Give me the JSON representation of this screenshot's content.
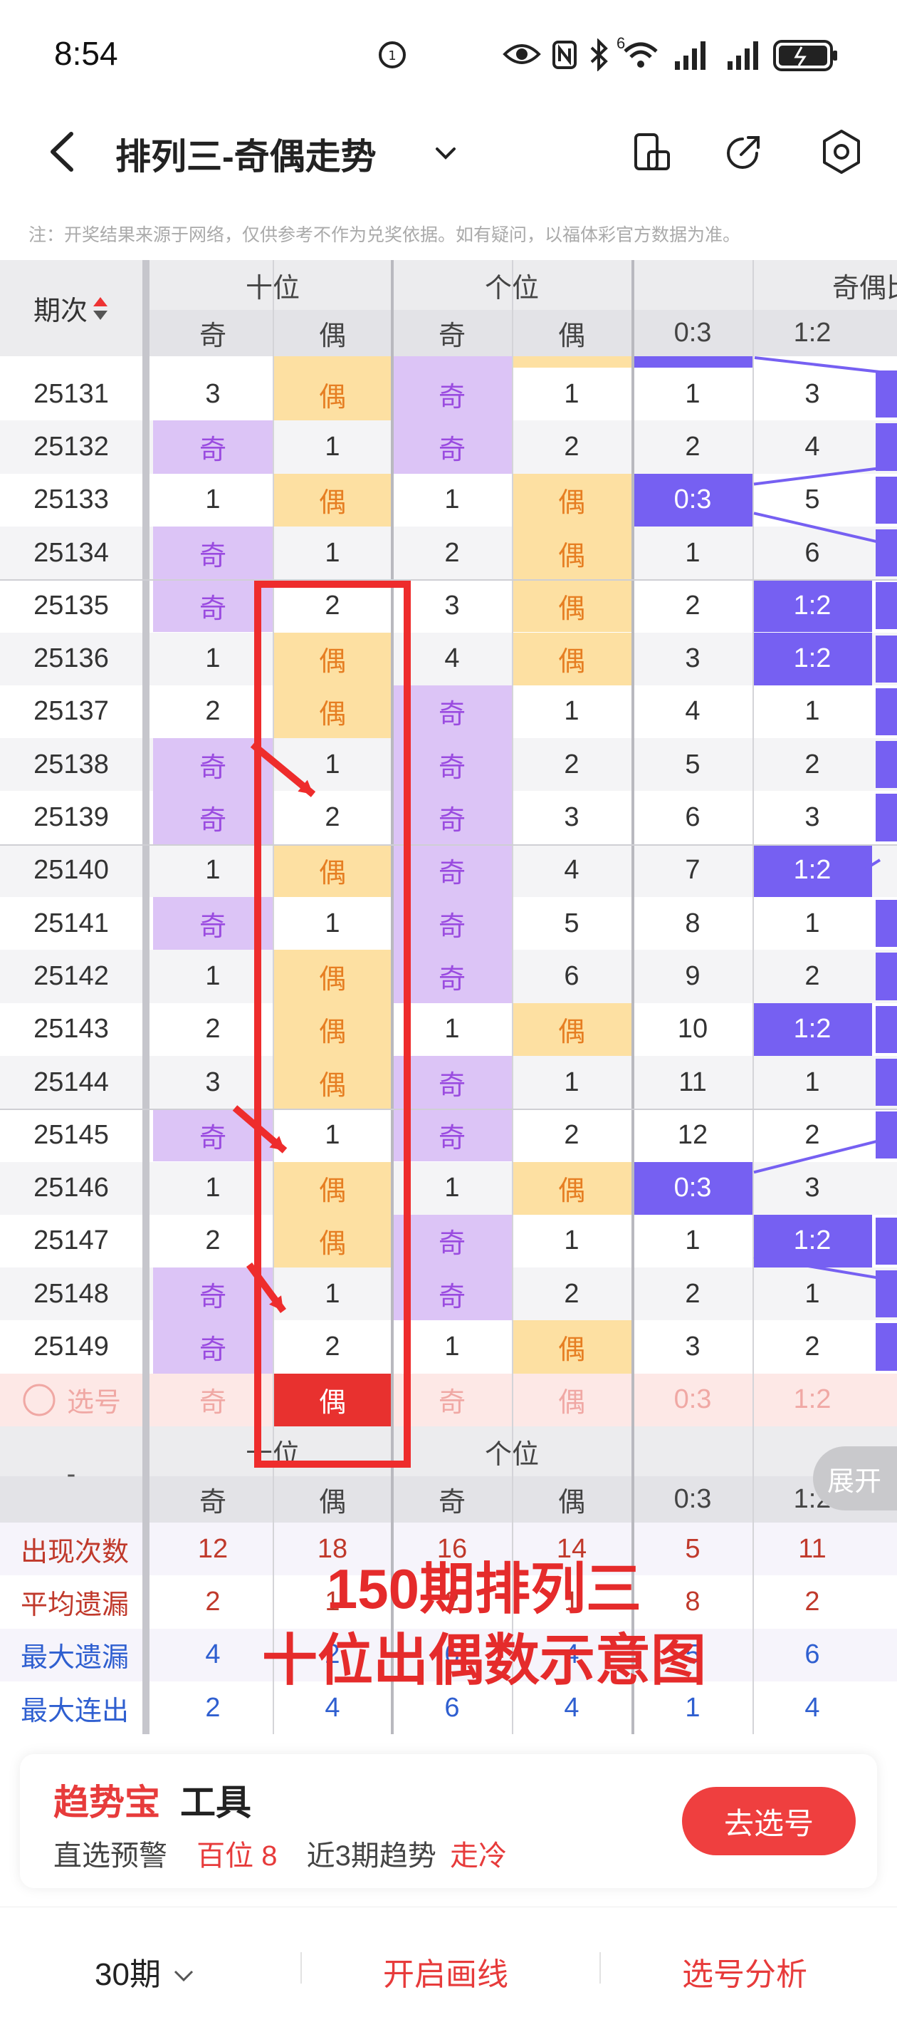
{
  "status_bar": {
    "time": "8:54",
    "signal_tag": "6"
  },
  "nav": {
    "title": "排列三-奇偶走势"
  },
  "notice": "注：开奖结果来源于网络，仅供参考不作为兑奖依据。如有疑问，以福体彩官方数据为准。",
  "table": {
    "header": {
      "issue_label": "期次",
      "groups": [
        "十位",
        "个位",
        "奇偶比"
      ],
      "sub_labels": [
        "奇",
        "偶",
        "奇",
        "偶",
        "0:3",
        "1:2"
      ]
    },
    "rows": [
      {
        "issue": "25131",
        "c": [
          "3",
          "偶",
          "奇",
          "1",
          "1",
          "3"
        ],
        "hl": [
          0,
          2,
          1,
          0,
          0,
          0
        ]
      },
      {
        "issue": "25132",
        "c": [
          "奇",
          "1",
          "奇",
          "2",
          "2",
          "4"
        ],
        "hl": [
          1,
          0,
          1,
          0,
          0,
          0
        ]
      },
      {
        "issue": "25133",
        "c": [
          "1",
          "偶",
          "1",
          "偶",
          "0:3",
          "5"
        ],
        "hl": [
          0,
          2,
          0,
          2,
          3,
          0
        ]
      },
      {
        "issue": "25134",
        "c": [
          "奇",
          "1",
          "2",
          "偶",
          "1",
          "6"
        ],
        "hl": [
          1,
          0,
          0,
          2,
          0,
          0
        ]
      },
      {
        "issue": "25135",
        "c": [
          "奇",
          "2",
          "3",
          "偶",
          "2",
          "1:2"
        ],
        "hl": [
          1,
          0,
          0,
          2,
          0,
          3
        ]
      },
      {
        "issue": "25136",
        "c": [
          "1",
          "偶",
          "4",
          "偶",
          "3",
          "1:2"
        ],
        "hl": [
          0,
          2,
          0,
          2,
          0,
          3
        ]
      },
      {
        "issue": "25137",
        "c": [
          "2",
          "偶",
          "奇",
          "1",
          "4",
          "1"
        ],
        "hl": [
          0,
          2,
          1,
          0,
          0,
          0
        ]
      },
      {
        "issue": "25138",
        "c": [
          "奇",
          "1",
          "奇",
          "2",
          "5",
          "2"
        ],
        "hl": [
          1,
          0,
          1,
          0,
          0,
          0
        ]
      },
      {
        "issue": "25139",
        "c": [
          "奇",
          "2",
          "奇",
          "3",
          "6",
          "3"
        ],
        "hl": [
          1,
          0,
          1,
          0,
          0,
          0
        ]
      },
      {
        "issue": "25140",
        "c": [
          "1",
          "偶",
          "奇",
          "4",
          "7",
          "1:2"
        ],
        "hl": [
          0,
          2,
          1,
          0,
          0,
          3
        ]
      },
      {
        "issue": "25141",
        "c": [
          "奇",
          "1",
          "奇",
          "5",
          "8",
          "1"
        ],
        "hl": [
          1,
          0,
          1,
          0,
          0,
          0
        ]
      },
      {
        "issue": "25142",
        "c": [
          "1",
          "偶",
          "奇",
          "6",
          "9",
          "2"
        ],
        "hl": [
          0,
          2,
          1,
          0,
          0,
          0
        ]
      },
      {
        "issue": "25143",
        "c": [
          "2",
          "偶",
          "1",
          "偶",
          "10",
          "1:2"
        ],
        "hl": [
          0,
          2,
          0,
          2,
          0,
          3
        ]
      },
      {
        "issue": "25144",
        "c": [
          "3",
          "偶",
          "奇",
          "1",
          "11",
          "1"
        ],
        "hl": [
          0,
          2,
          1,
          0,
          0,
          0
        ]
      },
      {
        "issue": "25145",
        "c": [
          "奇",
          "1",
          "奇",
          "2",
          "12",
          "2"
        ],
        "hl": [
          1,
          0,
          1,
          0,
          0,
          0
        ]
      },
      {
        "issue": "25146",
        "c": [
          "1",
          "偶",
          "1",
          "偶",
          "0:3",
          "3"
        ],
        "hl": [
          0,
          2,
          0,
          2,
          3,
          0
        ]
      },
      {
        "issue": "25147",
        "c": [
          "2",
          "偶",
          "奇",
          "1",
          "1",
          "1:2"
        ],
        "hl": [
          0,
          2,
          1,
          0,
          0,
          3
        ]
      },
      {
        "issue": "25148",
        "c": [
          "奇",
          "1",
          "奇",
          "2",
          "2",
          "1"
        ],
        "hl": [
          1,
          0,
          1,
          0,
          0,
          0
        ]
      },
      {
        "issue": "25149",
        "c": [
          "奇",
          "2",
          "1",
          "偶",
          "3",
          "2"
        ],
        "hl": [
          1,
          0,
          0,
          2,
          0,
          0
        ]
      }
    ],
    "select_row": {
      "label": "选号",
      "c": [
        "奇",
        "偶",
        "奇",
        "偶",
        "0:3",
        "1:2"
      ]
    },
    "stats_header": {
      "dash": "-",
      "groups": [
        "十位",
        "个位"
      ],
      "sub_labels": [
        "奇",
        "偶",
        "奇",
        "偶",
        "0:3",
        "1:2"
      ]
    },
    "stats": [
      {
        "label": "出现次数",
        "vals": [
          "12",
          "18",
          "16",
          "14",
          "5",
          "11"
        ],
        "color": "#c0392b"
      },
      {
        "label": "平均遗漏",
        "vals": [
          "2",
          "1",
          "2",
          "1",
          "8",
          "2"
        ],
        "color": "#c0392b"
      },
      {
        "label": "最大遗漏",
        "vals": [
          "4",
          "2",
          "6",
          "4",
          "5",
          "6"
        ],
        "color": "#2f5fd0"
      },
      {
        "label": "最大连出",
        "vals": [
          "2",
          "4",
          "6",
          "4",
          "1",
          "4"
        ],
        "color": "#2f5fd0"
      }
    ],
    "expand_label": "展开"
  },
  "annotation": {
    "line1": "150期排列三",
    "line2": "十位出偶数示意图"
  },
  "promo": {
    "brand": "趋势宝",
    "tool": "工具",
    "label1": "直选预警",
    "value1": "百位 8",
    "label2": "近3期趋势",
    "value2": "走冷",
    "button": "去选号"
  },
  "bottom_bar": {
    "periods": "30期",
    "draw_line": "开启画线",
    "analysis": "选号分析"
  },
  "colors": {
    "odd_bg": "#dcc4f6",
    "even_bg": "#fde0a2",
    "ratio_bg": "#7660f2",
    "accent_red": "#e73b3b"
  }
}
